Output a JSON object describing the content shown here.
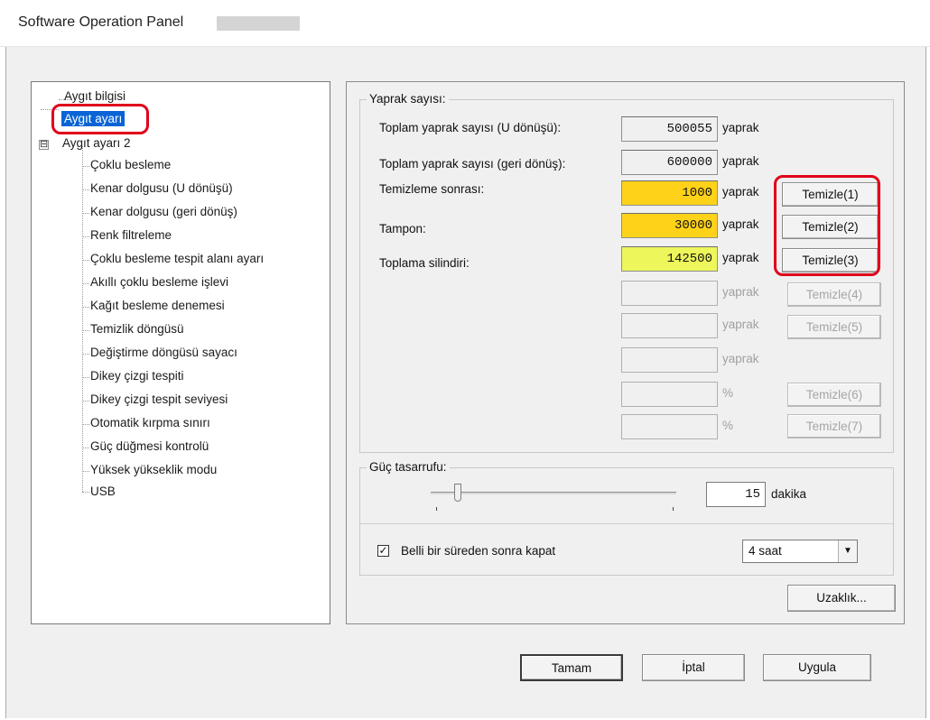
{
  "window": {
    "title": "Software Operation Panel"
  },
  "tree": {
    "items": [
      {
        "label": "Aygıt bilgisi"
      },
      {
        "label": "Aygıt ayarı"
      },
      {
        "label": "Aygıt ayarı 2"
      },
      {
        "label": "Çoklu besleme"
      },
      {
        "label": "Kenar dolgusu (U dönüşü)"
      },
      {
        "label": "Kenar dolgusu (geri dönüş)"
      },
      {
        "label": "Renk filtreleme"
      },
      {
        "label": "Çoklu besleme tespit alanı ayarı"
      },
      {
        "label": "Akıllı çoklu besleme işlevi"
      },
      {
        "label": "Kağıt besleme denemesi"
      },
      {
        "label": "Temizlik döngüsü"
      },
      {
        "label": "Değiştirme döngüsü sayacı"
      },
      {
        "label": "Dikey çizgi tespiti"
      },
      {
        "label": "Dikey çizgi tespit seviyesi"
      },
      {
        "label": "Otomatik kırpma sınırı"
      },
      {
        "label": "Güç düğmesi kontrolü"
      },
      {
        "label": "Yüksek yükseklik modu"
      },
      {
        "label": "USB"
      }
    ],
    "expander": "⊟"
  },
  "counts": {
    "group_title": "Yaprak sayısı:",
    "rows": [
      {
        "label": "Toplam yaprak sayısı (U dönüşü):",
        "value": "500055",
        "unit": "yaprak"
      },
      {
        "label": "Toplam yaprak sayısı (geri dönüş):",
        "value": "600000",
        "unit": "yaprak"
      },
      {
        "label": "Temizleme sonrası:",
        "value": "1000",
        "unit": "yaprak",
        "button": "Temizle(1)"
      },
      {
        "label": "Tampon:",
        "value": "30000",
        "unit": "yaprak",
        "button": "Temizle(2)"
      },
      {
        "label": "Toplama silindiri:",
        "value": "142500",
        "unit": "yaprak",
        "button": "Temizle(3)"
      },
      {
        "value": "",
        "unit": "yaprak",
        "button": "Temizle(4)"
      },
      {
        "value": "",
        "unit": "yaprak",
        "button": "Temizle(5)"
      },
      {
        "value": "",
        "unit": "yaprak"
      },
      {
        "value": "",
        "unit": "%",
        "button": "Temizle(6)"
      },
      {
        "value": "",
        "unit": "%",
        "button": "Temizle(7)"
      }
    ],
    "field_colors": {
      "cleaning": "#ffd21a",
      "pad": "#ffd21a",
      "pick_roller": "#edf65a"
    }
  },
  "power": {
    "group_title": "Güç tasarrufu:",
    "minutes_value": "15",
    "minutes_unit": "dakika",
    "slider_fraction": 0.11,
    "checkbox_label": "Belli bir süreden sonra kapat",
    "checkbox_checked": true,
    "checkbox_mark": "✓",
    "combo_value": "4 saat",
    "combo_arrow": "▼"
  },
  "buttons": {
    "remote": "Uzaklık...",
    "ok": "Tamam",
    "cancel": "İptal",
    "apply": "Uygula"
  },
  "highlight_color": "#e0001b"
}
